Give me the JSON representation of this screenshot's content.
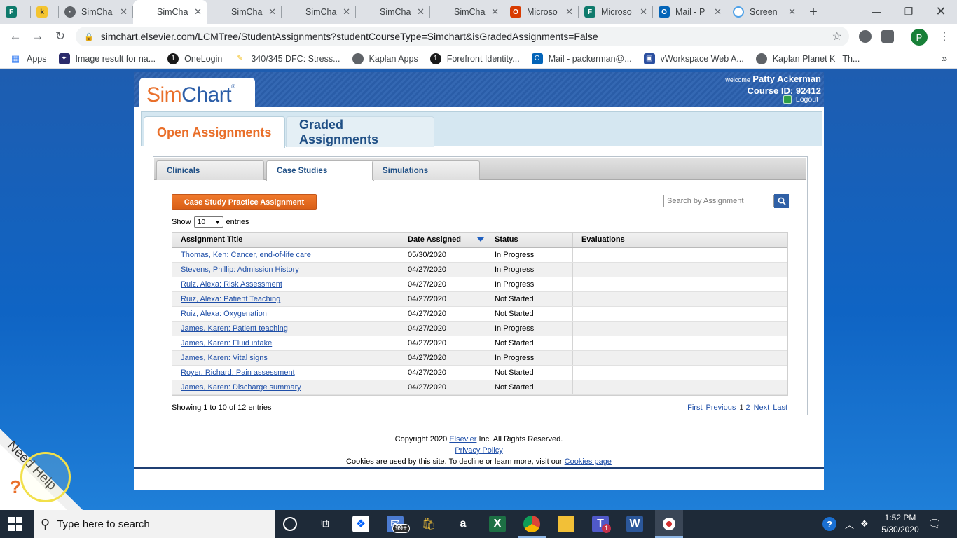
{
  "browser": {
    "tabs": [
      {
        "icon": "forms-icon",
        "title": "",
        "color": "#0e7a6c"
      },
      {
        "icon": "kaplan-icon",
        "title": "",
        "color": "#f4c430"
      },
      {
        "icon": "globe-icon",
        "title": "SimCha",
        "color": "#5f6368"
      },
      {
        "icon": "page-icon",
        "title": "SimCha",
        "color": "#5f6368",
        "active": true
      },
      {
        "icon": "page-icon",
        "title": "SimCha",
        "color": "#5f6368"
      },
      {
        "icon": "page-icon",
        "title": "SimCha",
        "color": "#5f6368"
      },
      {
        "icon": "page-icon",
        "title": "SimCha",
        "color": "#5f6368"
      },
      {
        "icon": "page-icon",
        "title": "SimCha",
        "color": "#5f6368"
      },
      {
        "icon": "office-icon",
        "title": "Microso",
        "color": "#d83b01"
      },
      {
        "icon": "forms-icon",
        "title": "Microso",
        "color": "#0e7a6c"
      },
      {
        "icon": "outlook-icon",
        "title": "Mail - P",
        "color": "#0364b8"
      },
      {
        "icon": "screencast-icon",
        "title": "Screen",
        "color": "#4ea1e8"
      }
    ],
    "url": "simchart.elsevier.com/LCMTree/StudentAssignments?studentCourseType=Simchart&isGradedAssignments=False",
    "profile_initial": "P",
    "bookmarks": [
      {
        "icon": "apps-icon",
        "label": "Apps",
        "color": "#4285f4"
      },
      {
        "icon": "butterfly-icon",
        "label": "Image result for na...",
        "color": "#2b2b6b"
      },
      {
        "icon": "onelogin-icon",
        "label": "OneLogin",
        "color": "#1a1a1a"
      },
      {
        "icon": "lightbulb-icon",
        "label": "340/345 DFC: Stress...",
        "color": "#f4c430"
      },
      {
        "icon": "globe-icon",
        "label": "Kaplan Apps",
        "color": "#5f6368"
      },
      {
        "icon": "forefront-icon",
        "label": "Forefront Identity...",
        "color": "#1a1a1a"
      },
      {
        "icon": "outlook-icon",
        "label": "Mail - packerman@...",
        "color": "#0364b8"
      },
      {
        "icon": "vworkspace-icon",
        "label": "vWorkspace Web A...",
        "color": "#2b4fa0"
      },
      {
        "icon": "globe-icon",
        "label": "Kaplan Planet K | Th...",
        "color": "#5f6368"
      }
    ]
  },
  "header": {
    "logo_sim": "Sim",
    "logo_chart": "Chart",
    "logo_reg": "®",
    "welcome": "welcome",
    "user_name": "Patty Ackerman",
    "course_id": "Course ID: 92412",
    "logout": "Logout"
  },
  "main_tabs": {
    "open": "Open Assignments",
    "graded": "Graded Assignments"
  },
  "sub_tabs": {
    "clinicals": "Clinicals",
    "case_studies": "Case Studies",
    "simulations": "Simulations"
  },
  "practice_button": "Case Study Practice Assignment",
  "search": {
    "placeholder": "Search by Assignment"
  },
  "entries": {
    "show": "Show",
    "value": "10",
    "suffix": "entries"
  },
  "table": {
    "headers": [
      "Assignment Title",
      "Date Assigned",
      "Status",
      "Evaluations"
    ],
    "rows": [
      [
        "Thomas, Ken: Cancer, end-of-life care",
        "05/30/2020",
        "In Progress",
        ""
      ],
      [
        "Stevens, Phillip: Admission History",
        "04/27/2020",
        "In Progress",
        ""
      ],
      [
        "Ruiz, Alexa: Risk Assessment",
        "04/27/2020",
        "In Progress",
        ""
      ],
      [
        "Ruiz, Alexa: Patient Teaching",
        "04/27/2020",
        "Not Started",
        ""
      ],
      [
        "Ruiz, Alexa: Oxygenation",
        "04/27/2020",
        "Not Started",
        ""
      ],
      [
        "James, Karen: Patient teaching",
        "04/27/2020",
        "In Progress",
        ""
      ],
      [
        "James, Karen: Fluid intake",
        "04/27/2020",
        "Not Started",
        ""
      ],
      [
        "James, Karen: Vital signs",
        "04/27/2020",
        "In Progress",
        ""
      ],
      [
        "Royer, Richard: Pain assessment",
        "04/27/2020",
        "Not Started",
        ""
      ],
      [
        "James, Karen: Discharge summary",
        "04/27/2020",
        "Not Started",
        ""
      ]
    ]
  },
  "showing": "Showing 1 to 10 of 12 entries",
  "pager": {
    "first": "First",
    "previous": "Previous",
    "page1": "1",
    "page2": "2",
    "next": "Next",
    "last": "Last"
  },
  "footer": {
    "copyright_pre": "Copyright 2020 ",
    "copyright_link": "Elsevier",
    "copyright_post": " Inc. All Rights Reserved.",
    "privacy": "Privacy Policy",
    "cookies_pre": "Cookies are used by this site. To decline or learn more, visit our ",
    "cookies_link": "Cookies page"
  },
  "need_help": "Need Help",
  "taskbar": {
    "search_placeholder": "Type here to search",
    "mail_badge": "99+",
    "teams_badge": "1",
    "time": "1:52 PM",
    "date": "5/30/2020"
  },
  "colors": {
    "brand_orange": "#e96f2a",
    "brand_blue": "#2c5ea8",
    "link_blue": "#1f4fa8"
  }
}
